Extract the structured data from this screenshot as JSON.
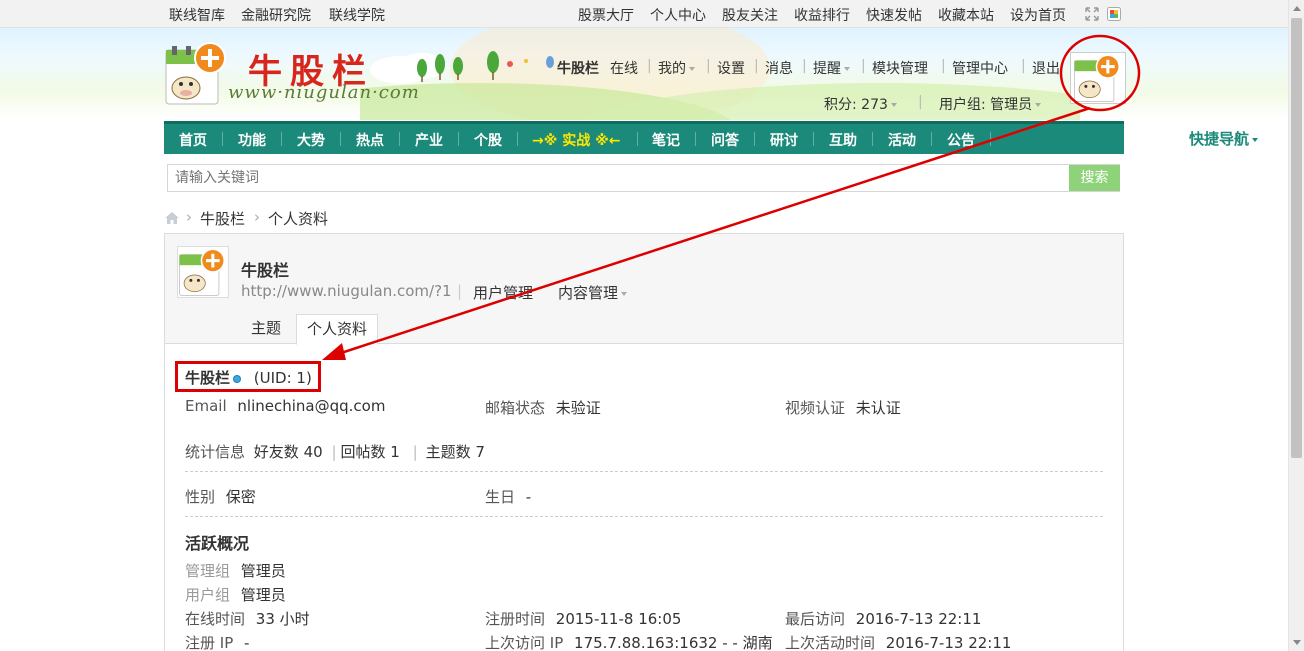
{
  "topbar": {
    "left_links": [
      "联线智库",
      "金融研究院",
      "联线学院"
    ],
    "right_links": [
      "股票大厅",
      "个人中心",
      "股友关注",
      "收益排行",
      "快速发帖",
      "收藏本站",
      "设为首页"
    ]
  },
  "header": {
    "logo_title": "牛股栏",
    "logo_url": "www·niugulan·com",
    "username": "牛股栏",
    "status": "在线",
    "menu": [
      "我的",
      "设置",
      "消息",
      "提醒",
      "模块管理",
      "管理中心",
      "退出"
    ],
    "points_label": "积分: 273",
    "group_label": "用户组: 管理员"
  },
  "nav": {
    "items": [
      "首页",
      "功能",
      "大势",
      "热点",
      "产业",
      "个股",
      "→※ 实战 ※←",
      "笔记",
      "问答",
      "研讨",
      "互助",
      "活动",
      "公告"
    ],
    "quick_nav": "快捷导航"
  },
  "search": {
    "placeholder": "请输入关键词",
    "button": "搜索"
  },
  "breadcrumb": {
    "items": [
      "牛股栏",
      "个人资料"
    ]
  },
  "profile": {
    "name": "牛股栏",
    "url": "http://www.niugulan.com/?1",
    "menu_user": "用户管理",
    "menu_content": "内容管理",
    "tabs": [
      "主题",
      "个人资料"
    ],
    "display_name": "牛股栏",
    "uid": "(UID: 1)",
    "email_label": "Email",
    "email": "nlinechina@qq.com",
    "email_status_label": "邮箱状态",
    "email_status": "未验证",
    "video_label": "视频认证",
    "video_status": "未认证",
    "stats_label": "统计信息",
    "friends": "好友数 40",
    "replies": "回帖数 1",
    "threads": "主题数 7",
    "gender_label": "性别",
    "gender": "保密",
    "birthday_label": "生日",
    "birthday": "-",
    "activity_title": "活跃概况",
    "admin_group_label": "管理组",
    "admin_group": "管理员",
    "user_group_label": "用户组",
    "user_group": "管理员",
    "online_time_label": "在线时间",
    "online_time": "33 小时",
    "reg_time_label": "注册时间",
    "reg_time": "2015-11-8 16:05",
    "last_visit_label": "最后访问",
    "last_visit": "2016-7-13 22:11",
    "reg_ip_label": "注册 IP",
    "reg_ip": "-",
    "prev_visit_ip_label": "上次访问 IP",
    "prev_visit_ip": "175.7.88.163:1632 - - 湖南",
    "last_active_label": "上次活动时间",
    "last_active": "2016-7-13 22:11"
  },
  "colors": {
    "nav_bg": "#1c8a7a",
    "logo_red": "#d8261c",
    "search_btn": "#8ed37a",
    "annotation_red": "#dd0000"
  }
}
